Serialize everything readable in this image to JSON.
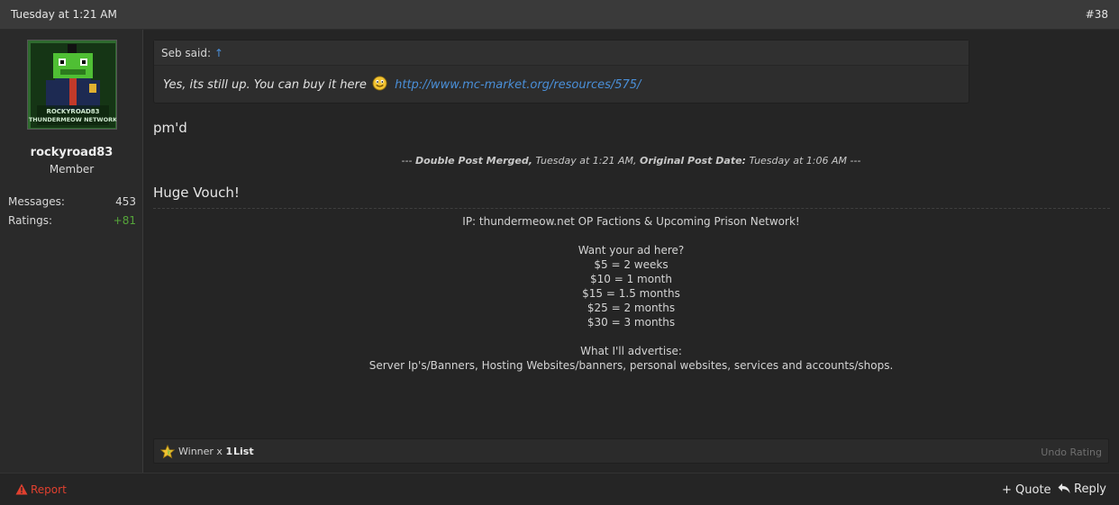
{
  "post": {
    "date": "Tuesday at 1:21 AM",
    "number": "#38"
  },
  "user": {
    "name": "rockyroad83",
    "title": "Member",
    "avatar_text_top": "ROCKYROAD83",
    "avatar_text_bottom": "THUNDERMEOW NETWORK",
    "stats": [
      {
        "label": "Messages:",
        "value": "453"
      },
      {
        "label": "Ratings:",
        "value": "+81"
      }
    ]
  },
  "quote": {
    "author": "Seb said:",
    "arrow": "↑",
    "text": "Yes, its still up. You can buy it here",
    "link": "http://www.mc-market.org/resources/575/"
  },
  "message": {
    "line1": "pm'd",
    "merged": {
      "prefix": "--- ",
      "label1": "Double Post Merged,",
      "time1": " Tuesday at 1:21 AM, ",
      "label2": "Original Post Date:",
      "time2": " Tuesday at 1:06 AM ---"
    },
    "line2": "Huge Vouch!"
  },
  "signature": {
    "lines": [
      "IP: thundermeow.net OP Factions & Upcoming Prison Network!",
      "",
      "Want your ad here?",
      "$5 = 2 weeks",
      "$10 = 1 month",
      "$15 = 1.5 months",
      "$25 = 2 months",
      "$30 = 3 months",
      "",
      "What I'll advertise:",
      "Server Ip's/Banners, Hosting Websites/banners, personal websites, services and accounts/shops."
    ]
  },
  "rating": {
    "label": "Winner x",
    "count": "1",
    "list": "List",
    "undo": "Undo Rating"
  },
  "actions": {
    "report": "Report",
    "quote": "+ Quote",
    "reply": "Reply"
  },
  "colors": {
    "link": "#4a8fd8",
    "positive": "#56a63a",
    "report": "#e0402f"
  }
}
